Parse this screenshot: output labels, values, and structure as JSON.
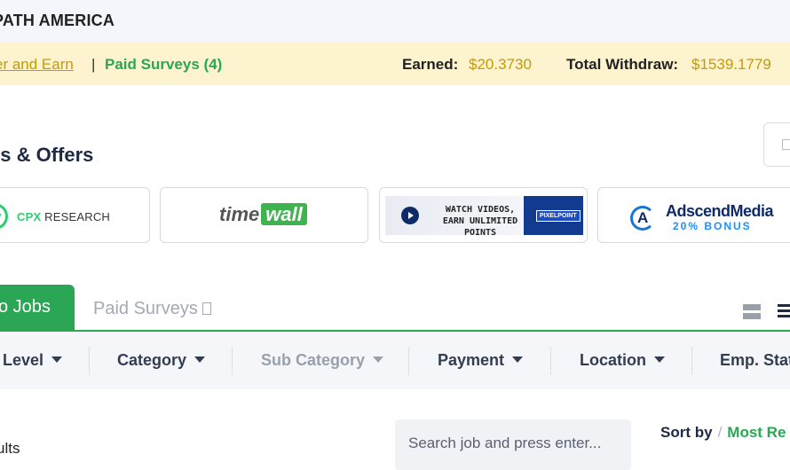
{
  "header": {
    "brand": "PATH AMERICA"
  },
  "earnbar": {
    "link_refer": "er and Earn",
    "separator": "|",
    "link_surveys": "Paid Surveys (4)",
    "earned_label": "Earned:",
    "earned_value": "$20.3730",
    "withdraw_label": "Total Withdraw:",
    "withdraw_value": "$1539.1779"
  },
  "offers": {
    "title": "ys & Offers",
    "items": [
      {
        "name": "CPX RESEARCH",
        "cpx_a": "CPX",
        "cpx_b": "RESEARCH"
      },
      {
        "name": "timewall",
        "tw_a": "time",
        "tw_b": "wall"
      },
      {
        "name": "PixelPoint",
        "line1": "WATCH VIDEOS,",
        "line2": "EARN UNLIMITED POINTS",
        "badge": "PIXELPOINT"
      },
      {
        "name": "AdscendMedia",
        "title": "AdscendMedia",
        "bonus": "20% BONUS"
      }
    ]
  },
  "tabs": {
    "active": "o Jobs",
    "inactive": "Paid Surveys"
  },
  "filters": [
    {
      "label": "Level"
    },
    {
      "label": "Category"
    },
    {
      "label": "Sub Category"
    },
    {
      "label": "Payment"
    },
    {
      "label": "Location"
    },
    {
      "label": "Emp. Stat"
    }
  ],
  "results": {
    "count_label": "ults",
    "search_placeholder": "Search job and press enter...",
    "sort_label": "Sort by",
    "sort_separator": "/",
    "sort_value": "Most Re"
  },
  "colors": {
    "accent_green": "#2aa655",
    "gold": "#c79a00",
    "earnbar_bg": "#fdf3cf",
    "navy": "#1e2a44"
  }
}
